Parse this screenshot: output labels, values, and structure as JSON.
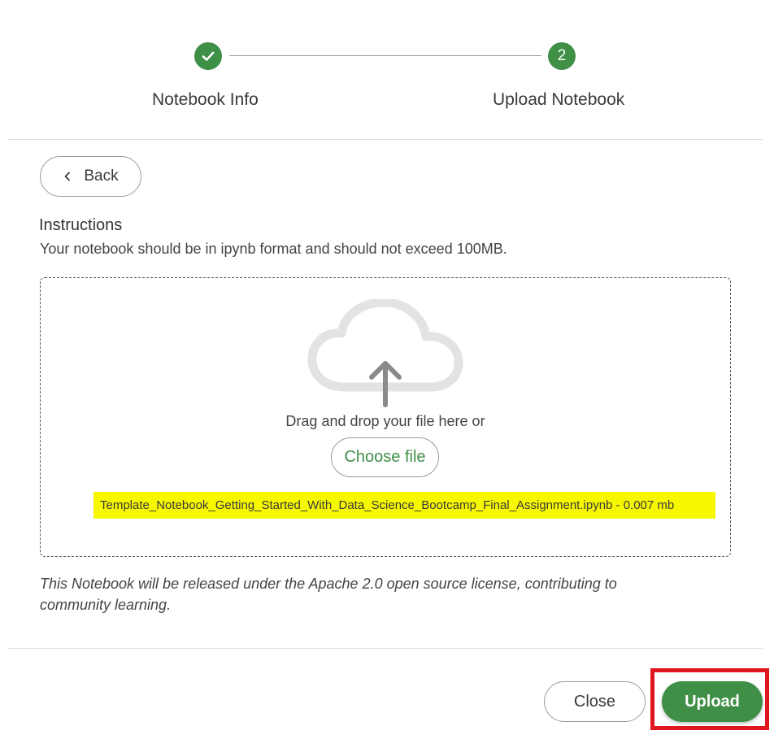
{
  "stepper": {
    "step1": {
      "label": "Notebook Info",
      "status": "completed",
      "icon": "check-icon"
    },
    "step2": {
      "number": "2",
      "label": "Upload Notebook",
      "status": "active"
    }
  },
  "back_button": {
    "label": "Back",
    "icon": "chevron-left-icon"
  },
  "instructions": {
    "title": "Instructions",
    "text": "Your notebook should be in ipynb format and should not exceed 100MB."
  },
  "dropzone": {
    "icon": "cloud-upload-icon",
    "prompt": "Drag and drop your file here or",
    "choose_label": "Choose file",
    "selected_file": "Template_Notebook_Getting_Started_With_Data_Science_Bootcamp_Final_Assignment.ipynb - 0.007 mb"
  },
  "license_text": "This Notebook will be released under the Apache 2.0 open source license, contributing to community learning.",
  "footer": {
    "close_label": "Close",
    "upload_label": "Upload"
  },
  "colors": {
    "accent": "#3f8f47",
    "file_highlight": "#f7f700",
    "annotation_box": "#e0161e"
  }
}
